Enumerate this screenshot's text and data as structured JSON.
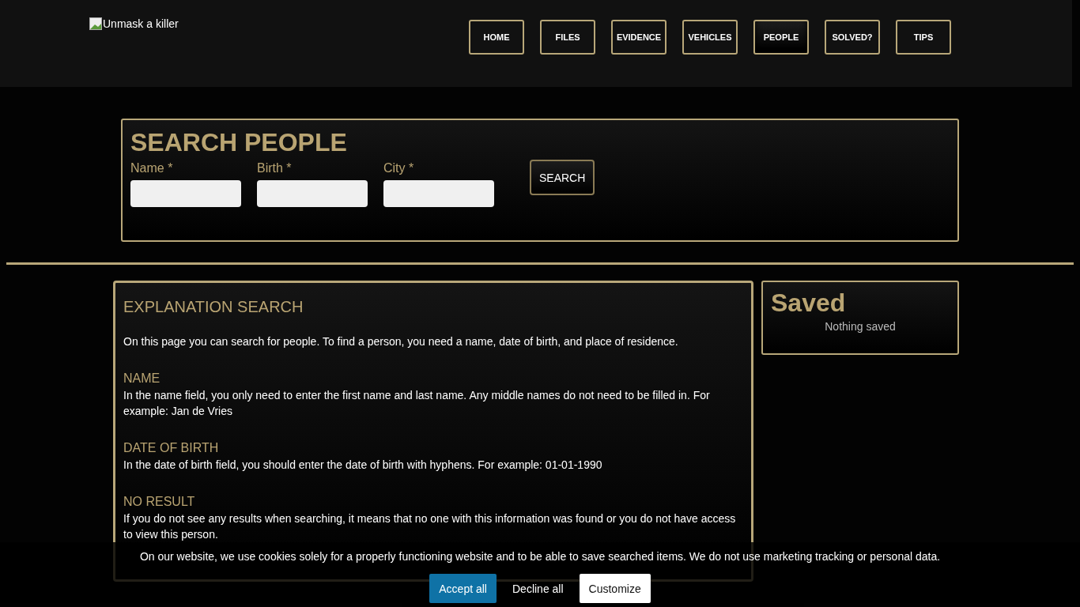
{
  "header": {
    "logo_alt": "Unmask a killer",
    "nav": [
      {
        "label": "HOME",
        "selected": false
      },
      {
        "label": "FILES",
        "selected": false
      },
      {
        "label": "EVIDENCE",
        "selected": false
      },
      {
        "label": "VEHICLES",
        "selected": false
      },
      {
        "label": "PEOPLE",
        "selected": true
      },
      {
        "label": "SOLVED?",
        "selected": false
      },
      {
        "label": "TIPS",
        "selected": false
      }
    ]
  },
  "search": {
    "title": "SEARCH PEOPLE",
    "fields": [
      {
        "label": "Name *"
      },
      {
        "label": "Birth *"
      },
      {
        "label": "City *"
      }
    ],
    "button": "SEARCH"
  },
  "explanation": {
    "title": "EXPLANATION SEARCH",
    "intro": "On this page you can search for people. To find a person, you need a name, date of birth, and place of residence.",
    "sections": [
      {
        "heading": "NAME",
        "text": "In the name field, you only need to enter the first name and last name. Any middle names do not need to be filled in. For example: Jan de Vries"
      },
      {
        "heading": "DATE OF BIRTH",
        "text": "In the date of birth field, you should enter the date of birth with hyphens. For example: 01-01-1990"
      },
      {
        "heading": "NO RESULT",
        "text": "If you do not see any results when searching, it means that no one with this information was found or you do not have access to view this person."
      }
    ]
  },
  "saved": {
    "title": "Saved",
    "empty": "Nothing saved"
  },
  "cookie_banner": {
    "text": "On our website, we use cookies solely for a properly functioning website and to be able to save searched items. We do not use marketing tracking or personal data.",
    "buttons": [
      {
        "label": "Accept all",
        "kind": "primary"
      },
      {
        "label": "Decline all",
        "kind": "plain"
      },
      {
        "label": "Customize",
        "kind": "light"
      }
    ]
  }
}
